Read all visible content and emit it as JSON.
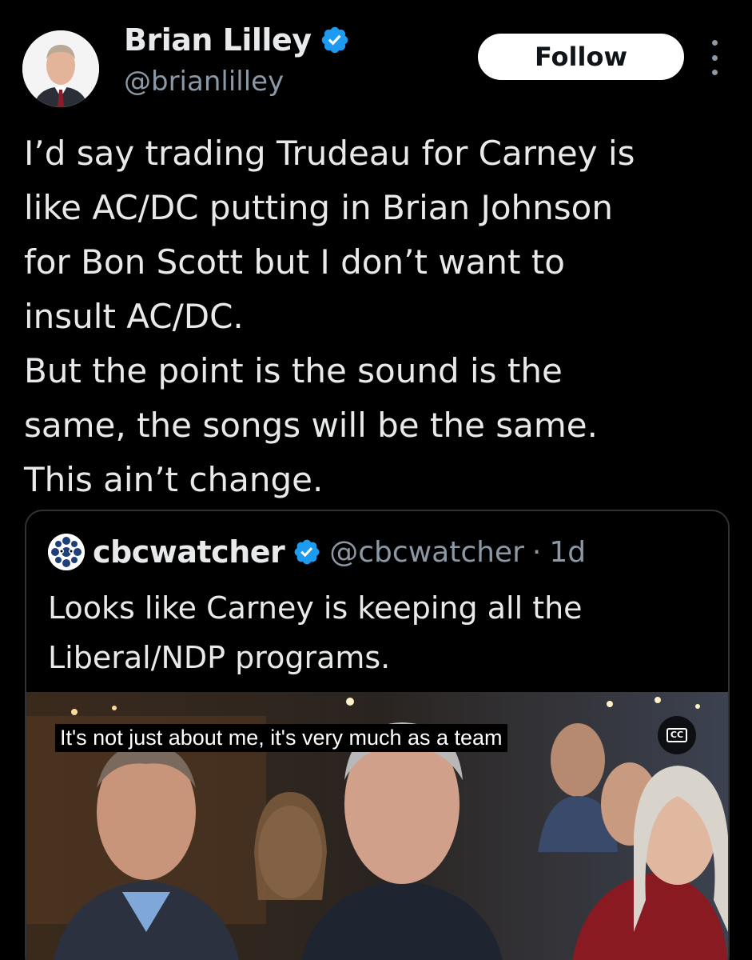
{
  "author": {
    "display_name": "Brian Lilley",
    "handle": "@brianlilley",
    "avatar_icon": "profile-photo",
    "verified_icon": "verified-badge-icon",
    "verified_color": "#1d9bf0"
  },
  "actions": {
    "follow_label": "Follow",
    "more_icon": "more-vertical-icon"
  },
  "tweet": {
    "lines": [
      "I’d say trading Trudeau for Carney is",
      "like AC/DC putting in Brian Johnson",
      "for Bon Scott but I don’t want to",
      "insult AC/DC.",
      "But the point is the sound is the",
      "same, the songs will be the same.",
      "This ain’t change."
    ]
  },
  "quoted": {
    "display_name": "cbcwatcher",
    "handle": "@cbcwatcher",
    "separator": "·",
    "time": "1d",
    "lines": [
      "Looks like Carney is keeping all the",
      "Liberal/NDP programs."
    ],
    "video": {
      "caption": "It's not just about me, it's very much as a team",
      "cc_label": "CC"
    }
  },
  "colors": {
    "background": "#000000",
    "text": "#e7e9ea",
    "secondary_text": "#8b98a5",
    "border": "#2f3336"
  }
}
